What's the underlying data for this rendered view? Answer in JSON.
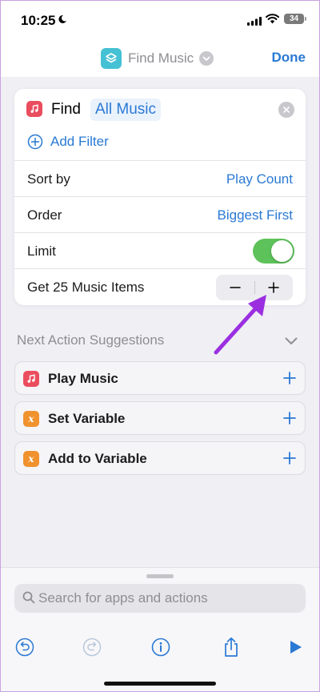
{
  "status_bar": {
    "time": "10:25",
    "battery": "34"
  },
  "nav": {
    "title": "Find Music",
    "done_label": "Done"
  },
  "action": {
    "find_label": "Find",
    "scope": "All Music",
    "add_filter": "Add Filter",
    "rows": [
      {
        "label": "Sort by",
        "value": "Play Count"
      },
      {
        "label": "Order",
        "value": "Biggest First"
      },
      {
        "label": "Limit",
        "toggle_on": true
      },
      {
        "label": "Get 25 Music Items"
      }
    ]
  },
  "suggestions": {
    "title": "Next Action Suggestions",
    "items": [
      {
        "label": "Play Music",
        "icon": "music-note-icon"
      },
      {
        "label": "Set Variable",
        "icon": "variable-icon",
        "glyph": "x"
      },
      {
        "label": "Add to Variable",
        "icon": "variable-icon",
        "glyph": "x"
      }
    ]
  },
  "search": {
    "placeholder": "Search for apps and actions"
  },
  "toolbar": [
    "undo-icon",
    "redo-icon",
    "info-icon",
    "share-icon",
    "play-icon"
  ],
  "colors": {
    "accent": "#2a79d4",
    "music": "#ea4d5e",
    "variable": "#f0922e",
    "toggle": "#5ec25a",
    "annotation": "#9b2fe0"
  }
}
